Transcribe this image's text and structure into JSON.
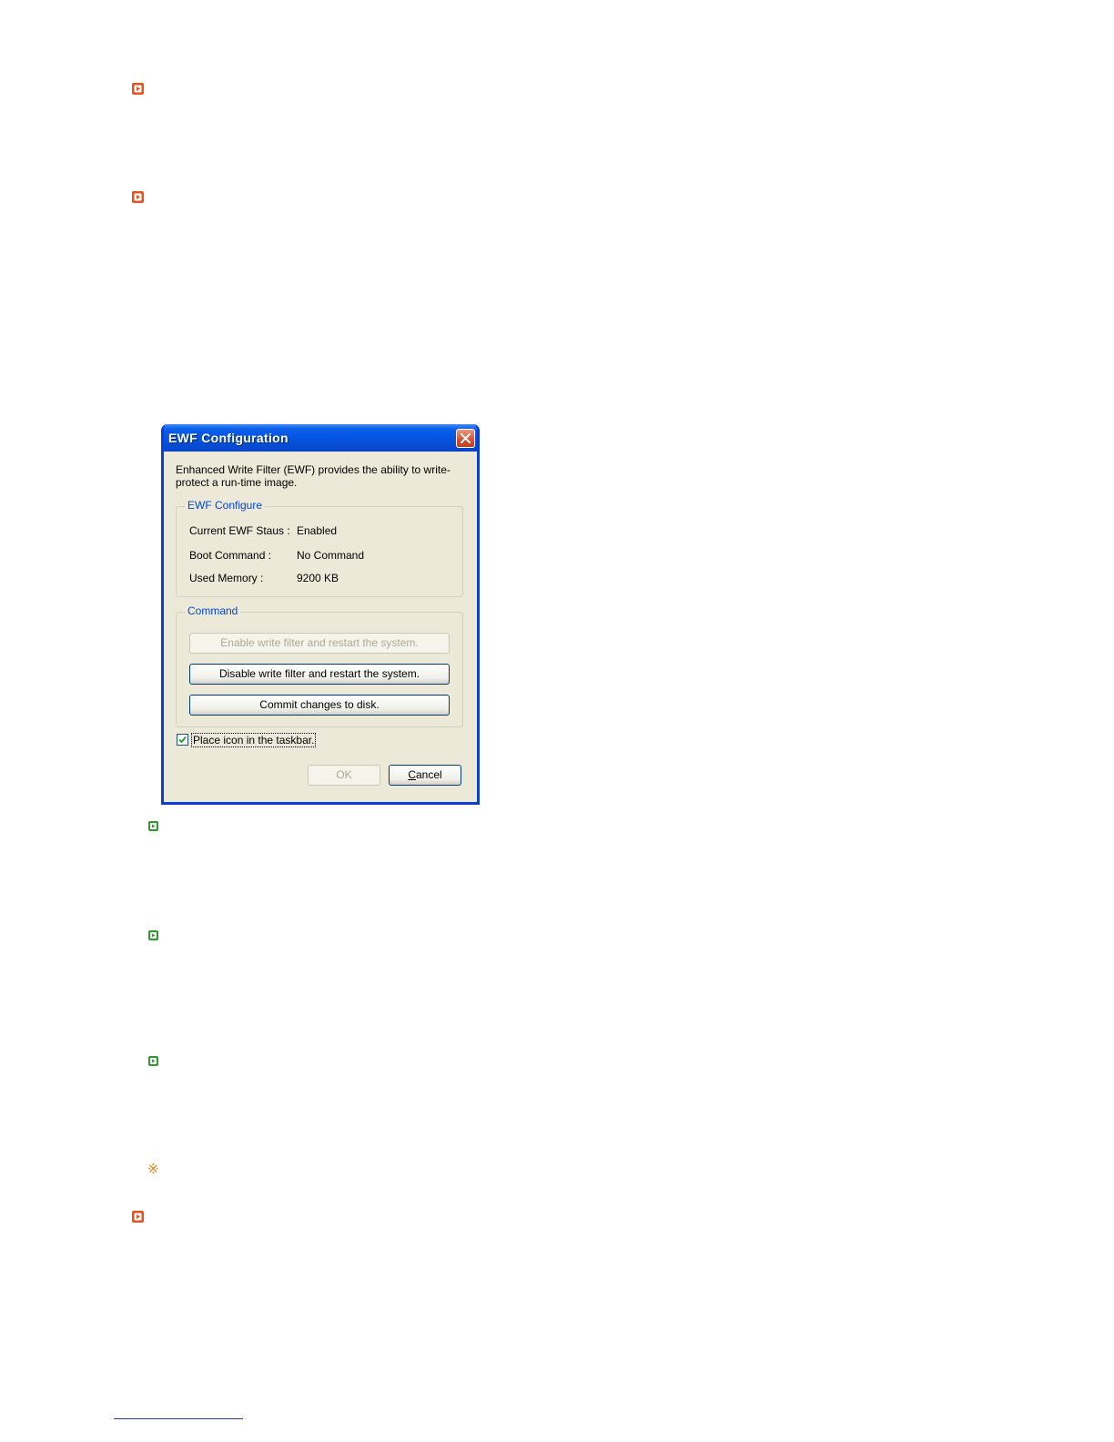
{
  "colors": {
    "section_bullet": "#e8521e",
    "step_bullet": "#2f9b2f",
    "note_mark": "#e8861e",
    "titlebar_blue": "#0553e0",
    "dialog_face": "#ece9d8",
    "group_label": "#0046d5"
  },
  "page": {
    "section_bullets": [
      "orange-play-bullet",
      "orange-play-bullet",
      "orange-play-bullet"
    ],
    "step_bullets": [
      "green-play-bullet",
      "green-play-bullet",
      "green-play-bullet"
    ],
    "note_mark": "※"
  },
  "dialog": {
    "title": "EWF Configuration",
    "close_icon": "close-x-icon",
    "intro": "Enhanced Write Filter (EWF) provides the ability to write-protect a run-time image.",
    "configure_group": {
      "legend": "EWF Configure",
      "rows": [
        {
          "label": "Current EWF Staus :",
          "value": "Enabled"
        },
        {
          "label": "Boot Command :",
          "value": "No Command"
        },
        {
          "label": "Used Memory :",
          "value": "9200 KB"
        }
      ]
    },
    "command_group": {
      "legend": "Command",
      "enable_button": "Enable write filter and restart the system.",
      "disable_button": "Disable write filter and restart the system.",
      "commit_button": "Commit changes to disk."
    },
    "taskbar_checkbox": {
      "label": "Place icon in the taskbar.",
      "checked": true
    },
    "ok_button": "OK",
    "cancel_button_prefix": "C",
    "cancel_button_rest": "ancel"
  }
}
